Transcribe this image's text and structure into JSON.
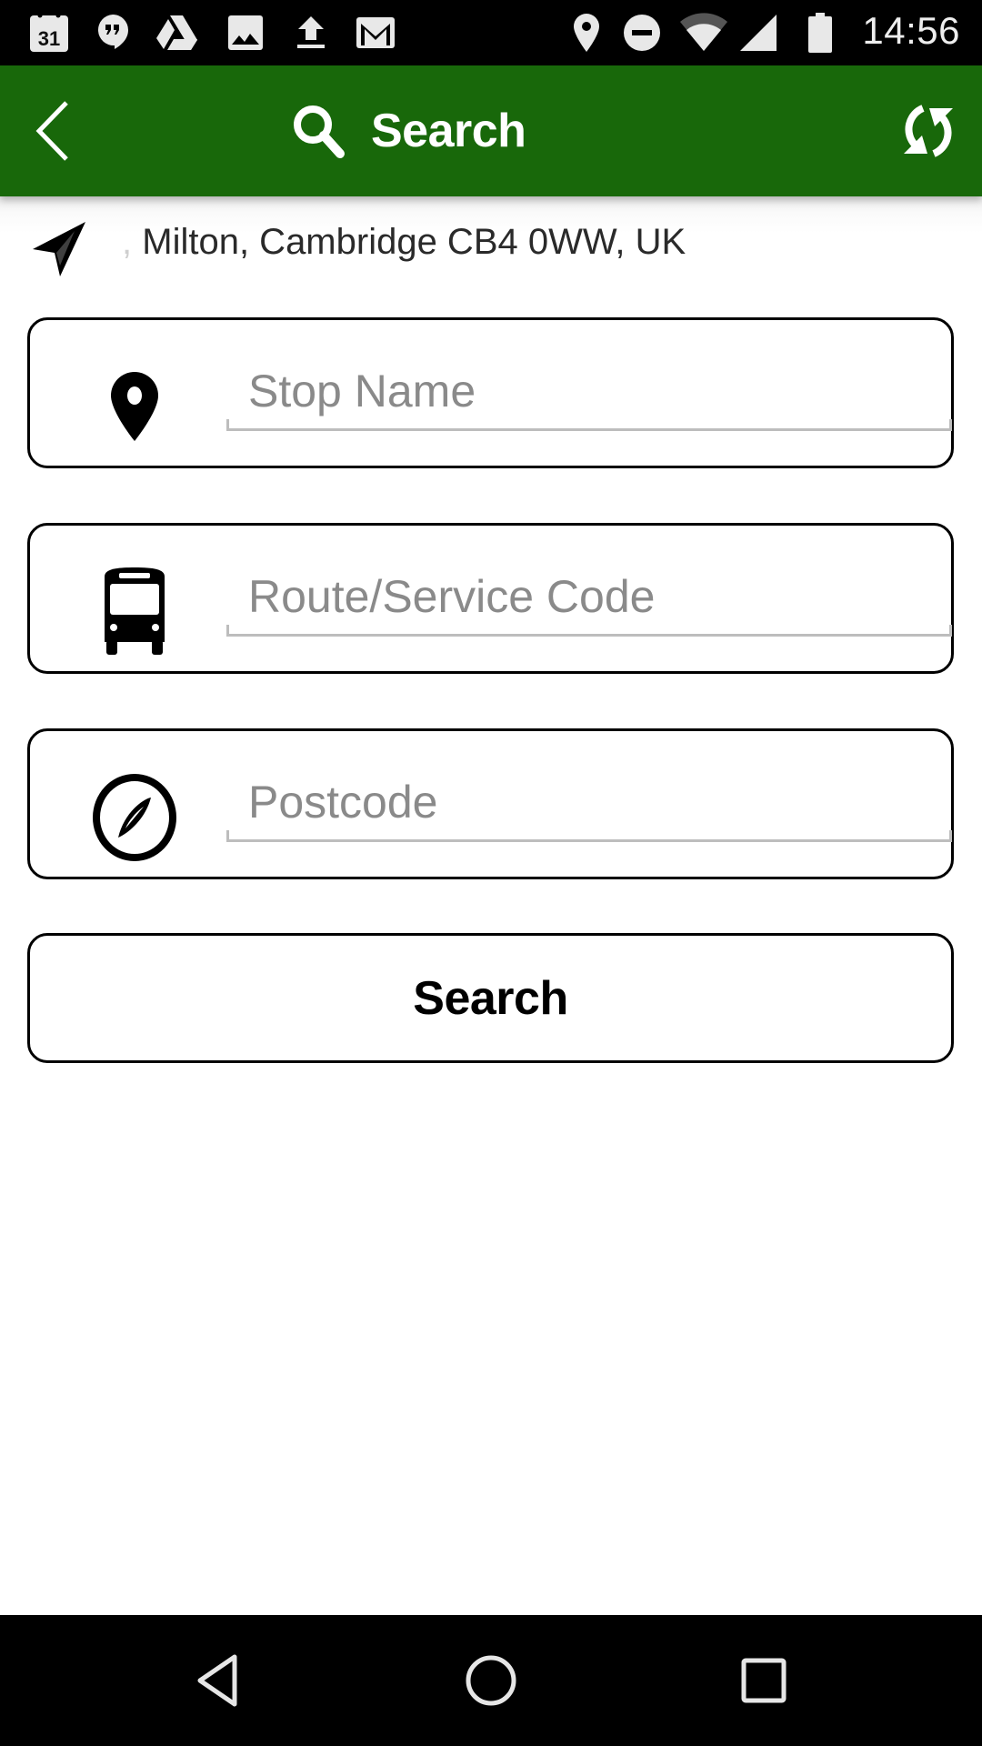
{
  "status_bar": {
    "time": "14:56",
    "left_icons": [
      "calendar-icon",
      "hangouts-icon",
      "drive-icon",
      "photos-icon",
      "upload-icon",
      "gmail-icon"
    ],
    "calendar_day": "31",
    "right_icons": [
      "location-icon",
      "do-not-disturb-icon",
      "wifi-icon",
      "cell-signal-icon",
      "battery-icon"
    ]
  },
  "app_bar": {
    "title": "Search",
    "back_icon": "chevron-left-icon",
    "title_icon": "search-icon",
    "refresh_icon": "refresh-icon",
    "background_color": "#18680a"
  },
  "location": {
    "icon": "navigation-arrow-icon",
    "prefix": ",",
    "address": "Milton, Cambridge CB4 0WW, UK"
  },
  "form": {
    "fields": [
      {
        "id": "stop-name",
        "icon": "map-pin-icon",
        "value": "",
        "placeholder": "Stop Name"
      },
      {
        "id": "route-code",
        "icon": "bus-icon",
        "value": "",
        "placeholder": "Route/Service Code"
      },
      {
        "id": "postcode",
        "icon": "compass-icon",
        "value": "",
        "placeholder": "Postcode"
      }
    ],
    "search_label": "Search"
  },
  "nav_bar": {
    "buttons": [
      "back-triangle-icon",
      "home-circle-icon",
      "recents-square-icon"
    ]
  }
}
